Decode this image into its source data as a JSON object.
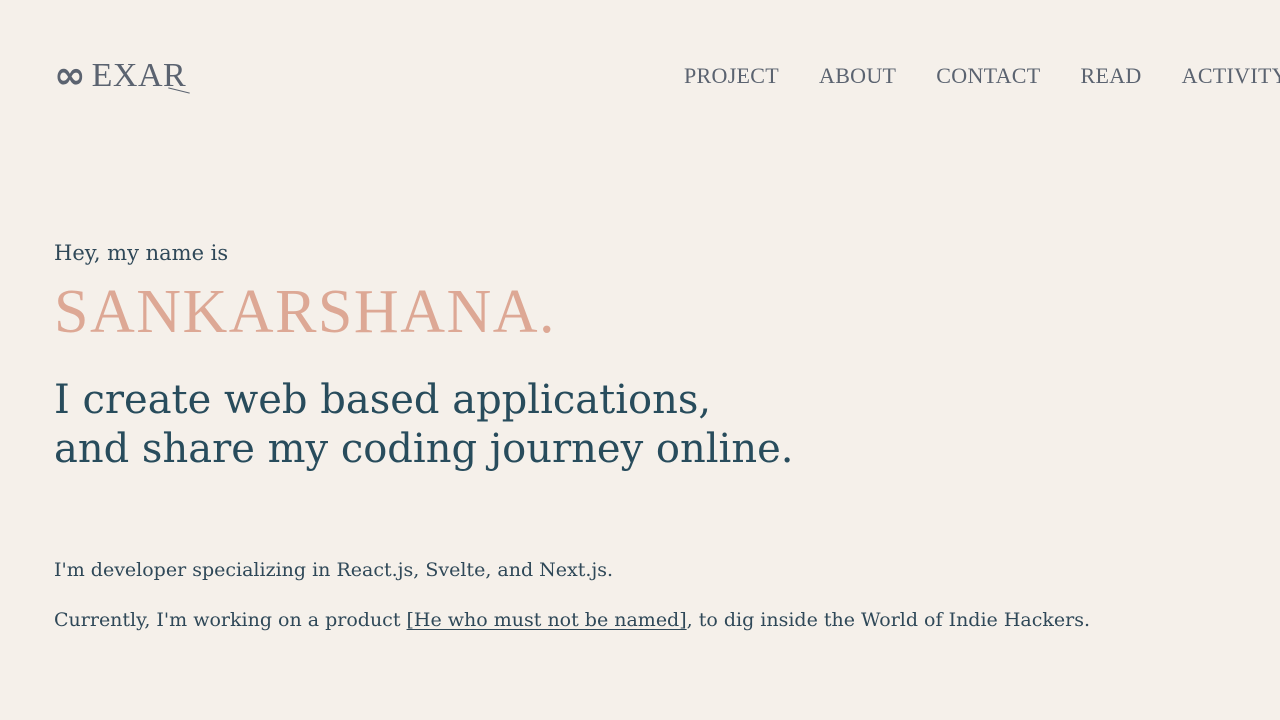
{
  "header": {
    "logo": {
      "icon": "infinity-icon",
      "icon_glyph": "∞",
      "text": "EXAR"
    },
    "nav": [
      {
        "label": "PROJECT"
      },
      {
        "label": "ABOUT"
      },
      {
        "label": "CONTACT"
      },
      {
        "label": "READ"
      },
      {
        "label": "ACTIVITY"
      }
    ]
  },
  "hero": {
    "intro": "Hey, my name is",
    "name": "SANKARSHANA.",
    "tagline_line1": "I create web based applications,",
    "tagline_line2": "and share my coding journey online."
  },
  "about": {
    "paragraph1": "I'm developer specializing in React.js, Svelte, and Next.js.",
    "paragraph2_prefix": "Currently, I'm working on a product ",
    "paragraph2_link": "[He who must not be named]",
    "paragraph2_suffix": ", to dig inside the World of Indie Hackers."
  },
  "colors": {
    "background": "#f5f0ea",
    "text": "#2f4858",
    "accent": "#dda895",
    "nav": "#5b6370"
  }
}
